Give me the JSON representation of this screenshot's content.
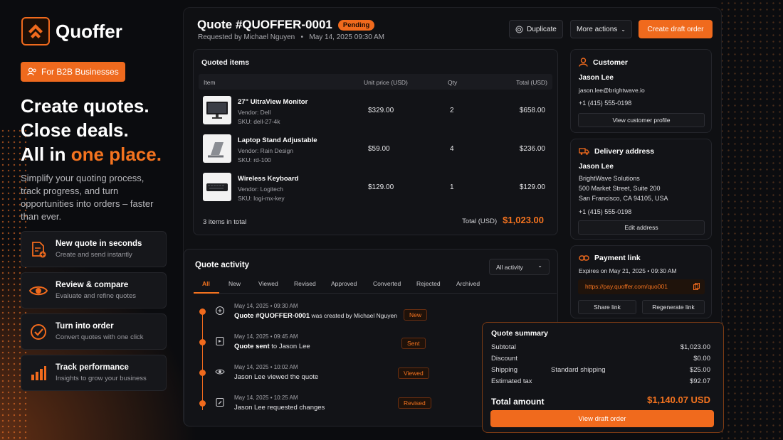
{
  "brand": {
    "name": "Quoffer",
    "tag": "For B2B Businesses"
  },
  "hero": {
    "line1": "Create quotes.",
    "line2": "Close deals.",
    "line3_prefix": "All in ",
    "line3_accent": "one place.",
    "subtext": "Simplify your quoting process, track progress, and turn opportunities into orders – faster than ever."
  },
  "features": [
    {
      "title": "New quote in seconds",
      "desc": "Create and send instantly",
      "icon": "document-plus-icon"
    },
    {
      "title": "Review & compare",
      "desc": "Evaluate and refine quotes",
      "icon": "eye-icon"
    },
    {
      "title": "Turn into order",
      "desc": "Convert quotes with one click",
      "icon": "check-circle-icon"
    },
    {
      "title": "Track performance",
      "desc": "Insights to grow your business",
      "icon": "bar-chart-icon"
    }
  ],
  "quote": {
    "title": "Quote #QUOFFER-0001",
    "status": "Pending",
    "requested": "Requested by Michael Nguyen",
    "date": "May 14, 2025 09:30 AM"
  },
  "actions": {
    "duplicate": "Duplicate",
    "more": "More actions",
    "create": "Create draft order"
  },
  "items": {
    "heading": "Quoted items",
    "columns": [
      "Item",
      "Unit price (USD)",
      "Qty",
      "Total (USD)"
    ],
    "rows": [
      {
        "name": "27\" UltraView Monitor",
        "vendor": "Vendor:   Dell",
        "sku": "SKU:   dell-27-4k",
        "price": "$329.00",
        "qty": "2",
        "total": "$658.00"
      },
      {
        "name": "Laptop Stand Adjustable",
        "vendor": "Vendor:   Rain Design",
        "sku": "SKU:   rd-100",
        "price": "$59.00",
        "qty": "4",
        "total": "$236.00"
      },
      {
        "name": "Wireless Keyboard",
        "vendor": "Vendor:   Logitech",
        "sku": "SKU:   logi-mx-key",
        "price": "$129.00",
        "qty": "1",
        "total": "$129.00"
      }
    ],
    "count": "3 items in total",
    "total_label": "Total (USD)",
    "total_value": "$1,023.00"
  },
  "customer": {
    "heading": "Customer",
    "name": "Jason Lee",
    "email": "jason.lee@brightwave.io",
    "phone": "+1 (415) 555-0198",
    "button": "View customer profile"
  },
  "delivery": {
    "heading": "Delivery address",
    "name": "Jason Lee",
    "company": "BrightWave Solutions",
    "street": "500 Market Street, Suite 200",
    "city": "San Francisco, CA 94105, USA",
    "phone": "+1 (415) 555-0198",
    "button": "Edit address"
  },
  "payment": {
    "heading": "Payment link",
    "expires": "Expires on May 21, 2025 • 09:30 AM",
    "url": "https://pay.quoffer.com/quo001",
    "share": "Share link",
    "regen": "Regenerate link"
  },
  "activity": {
    "heading": "Quote activity",
    "filter": "All activity",
    "tabs": [
      "All",
      "New",
      "Viewed",
      "Revised",
      "Approved",
      "Converted",
      "Rejected",
      "Archived"
    ],
    "events": [
      {
        "time": "May 14, 2025 • 09:30 AM",
        "bold": "Quote #QUOFFER-0001",
        "text": " was created by Michael Nguyen",
        "badge": "New",
        "icon": "plus-circle-icon"
      },
      {
        "time": "May 14, 2025 • 09:45 AM",
        "bold": "Quote sent",
        "text": " to Jason Lee",
        "badge": "Sent",
        "icon": "send-icon"
      },
      {
        "time": "May 14, 2025 • 10:02 AM",
        "bold": "",
        "text": "Jason Lee viewed the quote",
        "badge": "Viewed",
        "icon": "eye-icon"
      },
      {
        "time": "May 14, 2025 • 10:25 AM",
        "bold": "",
        "text": "Jason Lee requested changes",
        "badge": "Revised",
        "icon": "edit-icon"
      }
    ]
  },
  "summary": {
    "heading": "Quote summary",
    "rows": [
      {
        "label": "Subtotal",
        "mid": "",
        "value": "$1,023.00"
      },
      {
        "label": "Discount",
        "mid": "",
        "value": "$0.00"
      },
      {
        "label": "Shipping",
        "mid": "Standard shipping",
        "value": "$25.00"
      },
      {
        "label": "Estimated tax",
        "mid": "",
        "value": "$92.07"
      }
    ],
    "total_label": "Total amount",
    "total_value": "$1,140.07 USD",
    "button": "View draft order"
  },
  "colors": {
    "accent": "#f06a1d",
    "background": "#0b0c0f",
    "panel": "#121317"
  }
}
